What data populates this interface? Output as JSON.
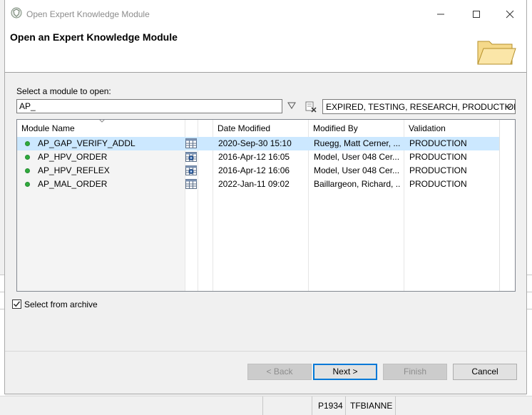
{
  "window": {
    "title": "Open Expert Knowledge Module",
    "header_title": "Open an Expert Knowledge Module",
    "icon": "shield-icon",
    "controls": [
      "minimize-icon",
      "maximize-icon",
      "close-icon"
    ]
  },
  "search": {
    "label": "Select a module to open:",
    "value": "AP_"
  },
  "status_filter": {
    "value": "EXPIRED, TESTING, RESEARCH, PRODUCTION, "
  },
  "table": {
    "columns": [
      "Module Name",
      "Date Modified",
      "Modified By",
      "Validation"
    ],
    "rows": [
      {
        "name": "AP_GAP_VERIFY_ADDL",
        "date": "2020-Sep-30 15:10",
        "by": "Ruegg, Matt Cerner, ...",
        "validation": "PRODUCTION",
        "icon": "grid-icon",
        "selected": true
      },
      {
        "name": "AP_HPV_ORDER",
        "date": "2016-Apr-12 16:05",
        "by": "Model, User 048 Cer...",
        "validation": "PRODUCTION",
        "icon": "grid-settings-icon",
        "selected": false
      },
      {
        "name": "AP_HPV_REFLEX",
        "date": "2016-Apr-12 16:06",
        "by": "Model, User 048 Cer...",
        "validation": "PRODUCTION",
        "icon": "grid-settings-icon",
        "selected": false
      },
      {
        "name": "AP_MAL_ORDER",
        "date": "2022-Jan-11 09:02",
        "by": "Baillargeon, Richard, ...",
        "validation": "PRODUCTION",
        "icon": "grid-icon",
        "selected": false
      }
    ]
  },
  "archive": {
    "label": "Select from archive",
    "checked": true
  },
  "buttons": {
    "back": "< Back",
    "next": "Next >",
    "finish": "Finish",
    "cancel": "Cancel"
  },
  "statusbar": {
    "code": "P1934",
    "user": "TFBIANNE"
  }
}
